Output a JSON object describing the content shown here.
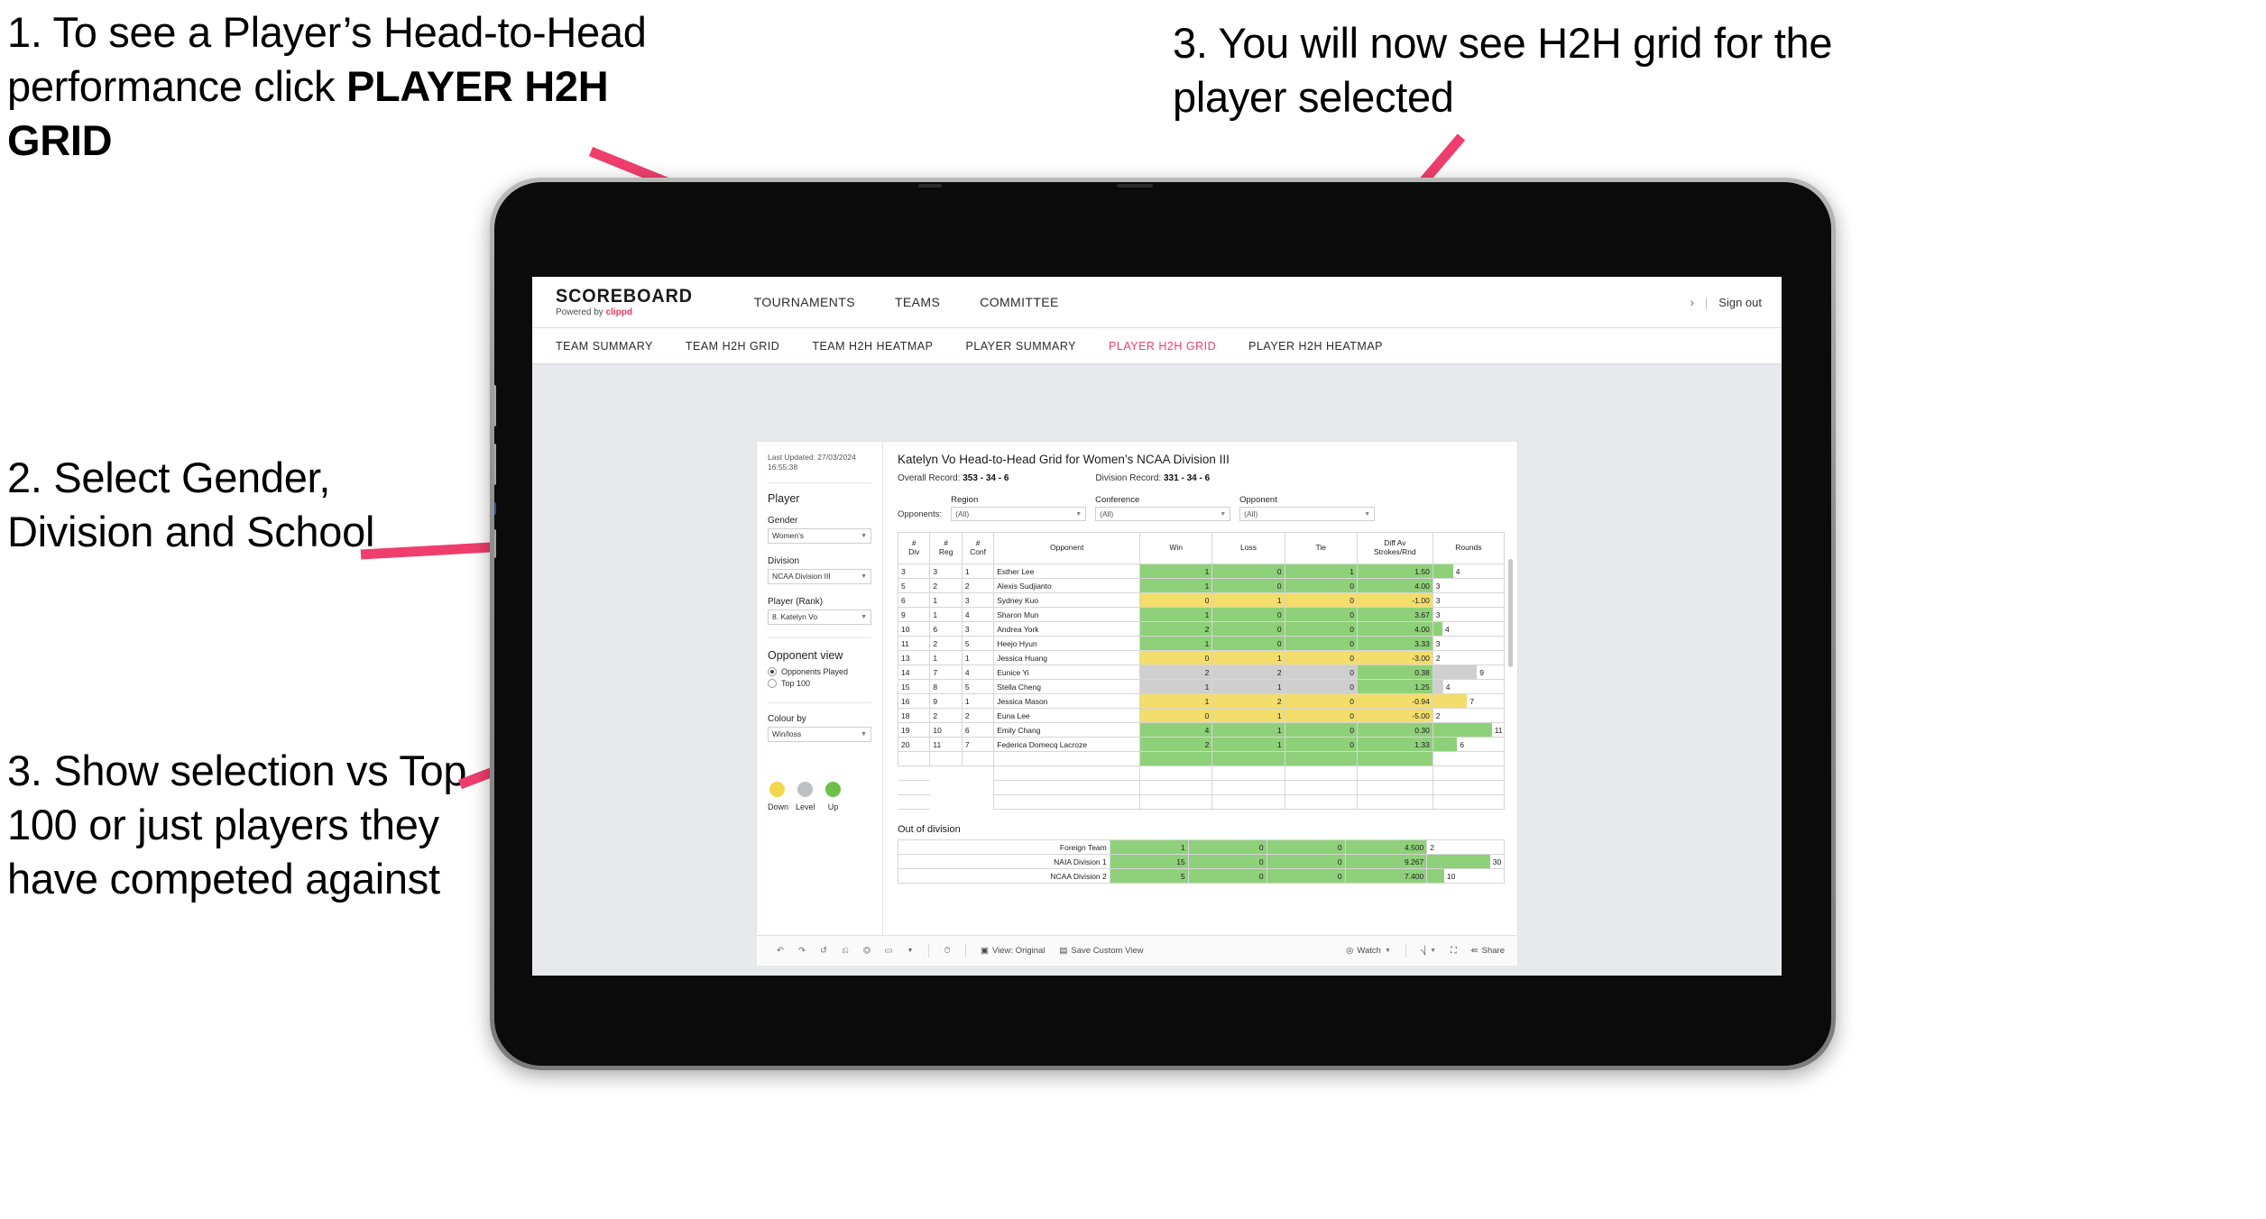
{
  "annotations": [
    {
      "id": "a1",
      "text_plain": "1. To see a Player’s Head-to-Head performance click ",
      "bold": "PLAYER H2H GRID"
    },
    {
      "id": "a2",
      "text": "2. Select Gender, Division and School"
    },
    {
      "id": "a3",
      "text": "3. Show selection vs Top 100 or just players they have competed against"
    },
    {
      "id": "a4",
      "text": "3. You will now see H2H grid for the player selected"
    }
  ],
  "colors": {
    "accent_pink": "#ef3e6d",
    "win_green": "#8fd07a",
    "loss_yellow": "#f3dd6b",
    "tie_grey": "#cfcfcf",
    "canvas_bg": "#e7e9ed"
  },
  "header": {
    "brand_name": "SCOREBOARD",
    "brand_sub_prefix": "Powered by ",
    "brand_sub_accent": "clippd",
    "nav": [
      {
        "label": "TOURNAMENTS"
      },
      {
        "label": "TEAMS"
      },
      {
        "label": "COMMITTEE"
      }
    ],
    "chevron": "›",
    "divider": "|",
    "sign_out": "Sign out"
  },
  "subnav": {
    "tabs": [
      {
        "label": "TEAM SUMMARY",
        "active": false
      },
      {
        "label": "TEAM H2H GRID",
        "active": false
      },
      {
        "label": "TEAM H2H HEATMAP",
        "active": false
      },
      {
        "label": "PLAYER SUMMARY",
        "active": false
      },
      {
        "label": "PLAYER H2H GRID",
        "active": true
      },
      {
        "label": "PLAYER H2H HEATMAP",
        "active": false
      }
    ]
  },
  "filters": {
    "last_updated": "Last Updated: 27/03/2024 16:55:38",
    "section_title": "Player",
    "gender_label": "Gender",
    "gender_value": "Women's",
    "division_label": "Division",
    "division_value": "NCAA Division III",
    "player_label": "Player (Rank)",
    "player_value": "8. Katelyn Vo",
    "opponent_view_title": "Opponent view",
    "opponent_view_options": [
      {
        "label": "Opponents Played",
        "selected": true
      },
      {
        "label": "Top 100",
        "selected": false
      }
    ],
    "colour_by_label": "Colour by",
    "colour_by_value": "Win/loss",
    "legend": [
      {
        "label": "Down",
        "color": "#f2d84f"
      },
      {
        "label": "Level",
        "color": "#bdc1c4"
      },
      {
        "label": "Up",
        "color": "#6cbf4a"
      }
    ]
  },
  "viz": {
    "title": "Katelyn Vo Head-to-Head Grid for Women’s NCAA Division III",
    "overall_record_label": "Overall Record: ",
    "overall_record_value": "353 - 34 - 6",
    "division_record_label": "Division Record: ",
    "division_record_value": "331 - 34 - 6",
    "opponents_label": "Opponents:",
    "opponent_filters": [
      {
        "caption": "Region",
        "value": "(All)"
      },
      {
        "caption": "Conference",
        "value": "(All)"
      },
      {
        "caption": "Opponent",
        "value": "(All)"
      }
    ],
    "columns": [
      {
        "l1": "#",
        "l2": "Div"
      },
      {
        "l1": "#",
        "l2": "Reg"
      },
      {
        "l1": "#",
        "l2": "Conf"
      },
      {
        "l1": "Opponent",
        "l2": ""
      },
      {
        "l1": "Win",
        "l2": ""
      },
      {
        "l1": "Loss",
        "l2": ""
      },
      {
        "l1": "Tie",
        "l2": ""
      },
      {
        "l1": "Diff Av",
        "l2": "Strokes/Rnd"
      },
      {
        "l1": "Rounds",
        "l2": ""
      }
    ],
    "rows": [
      {
        "div": "3",
        "reg": "3",
        "conf": "1",
        "opponent": "Esther Lee",
        "win": "1",
        "loss": "0",
        "tie": "1",
        "diff": "1.50",
        "rounds": "4",
        "state": "up",
        "rounds_pct": 28
      },
      {
        "div": "5",
        "reg": "2",
        "conf": "2",
        "opponent": "Alexis Sudjianto",
        "win": "1",
        "loss": "0",
        "tie": "0",
        "diff": "4.00",
        "rounds": "3",
        "state": "up",
        "rounds_pct": 0
      },
      {
        "div": "6",
        "reg": "1",
        "conf": "3",
        "opponent": "Sydney Kuo",
        "win": "0",
        "loss": "1",
        "tie": "0",
        "diff": "-1.00",
        "rounds": "3",
        "state": "down",
        "rounds_pct": 0
      },
      {
        "div": "9",
        "reg": "1",
        "conf": "4",
        "opponent": "Sharon Mun",
        "win": "1",
        "loss": "0",
        "tie": "0",
        "diff": "3.67",
        "rounds": "3",
        "state": "up",
        "rounds_pct": 0
      },
      {
        "div": "10",
        "reg": "6",
        "conf": "3",
        "opponent": "Andrea York",
        "win": "2",
        "loss": "0",
        "tie": "0",
        "diff": "4.00",
        "rounds": "4",
        "state": "up",
        "rounds_pct": 13
      },
      {
        "div": "11",
        "reg": "2",
        "conf": "5",
        "opponent": "Heejo Hyun",
        "win": "1",
        "loss": "0",
        "tie": "0",
        "diff": "3.33",
        "rounds": "3",
        "state": "up",
        "rounds_pct": 0
      },
      {
        "div": "13",
        "reg": "1",
        "conf": "1",
        "opponent": "Jessica Huang",
        "win": "0",
        "loss": "1",
        "tie": "0",
        "diff": "-3.00",
        "rounds": "2",
        "state": "down",
        "rounds_pct": 0
      },
      {
        "div": "14",
        "reg": "7",
        "conf": "4",
        "opponent": "Eunice Yi",
        "win": "2",
        "loss": "2",
        "tie": "0",
        "diff": "0.38",
        "rounds": "9",
        "state": "level",
        "diff_state": "up",
        "rounds_pct": 62
      },
      {
        "div": "15",
        "reg": "8",
        "conf": "5",
        "opponent": "Stella Cheng",
        "win": "1",
        "loss": "1",
        "tie": "0",
        "diff": "1.25",
        "rounds": "4",
        "state": "level",
        "diff_state": "up",
        "rounds_pct": 14
      },
      {
        "div": "16",
        "reg": "9",
        "conf": "1",
        "opponent": "Jessica Mason",
        "win": "1",
        "loss": "2",
        "tie": "0",
        "diff": "-0.94",
        "rounds": "7",
        "state": "down",
        "rounds_pct": 48
      },
      {
        "div": "18",
        "reg": "2",
        "conf": "2",
        "opponent": "Euna Lee",
        "win": "0",
        "loss": "1",
        "tie": "0",
        "diff": "-5.00",
        "rounds": "2",
        "state": "down",
        "rounds_pct": 0
      },
      {
        "div": "19",
        "reg": "10",
        "conf": "6",
        "opponent": "Emily Chang",
        "win": "4",
        "loss": "1",
        "tie": "0",
        "diff": "0.30",
        "rounds": "11",
        "state": "up",
        "rounds_pct": 83
      },
      {
        "div": "20",
        "reg": "11",
        "conf": "7",
        "opponent": "Federica Domecq Lacroze",
        "win": "2",
        "loss": "1",
        "tie": "0",
        "diff": "1.33",
        "rounds": "6",
        "state": "up",
        "rounds_pct": 34
      }
    ],
    "out_of_division_title": "Out of division",
    "out_of_division_rows": [
      {
        "name": "Foreign Team",
        "win": "1",
        "loss": "0",
        "tie": "0",
        "diff": "4.500",
        "rounds": "2",
        "state": "up",
        "rounds_pct": 0
      },
      {
        "name": "NAIA Division 1",
        "win": "15",
        "loss": "0",
        "tie": "0",
        "diff": "9.267",
        "rounds": "30",
        "state": "up",
        "rounds_pct": 82
      },
      {
        "name": "NCAA Division 2",
        "win": "5",
        "loss": "0",
        "tie": "0",
        "diff": "7.400",
        "rounds": "10",
        "state": "up",
        "rounds_pct": 22
      }
    ]
  },
  "toolbar": {
    "icons": [
      "undo-icon",
      "redo-icon",
      "revert-icon",
      "refresh-icon",
      "pause-icon",
      "rect-select-icon",
      "caret-down-icon",
      "clock-icon"
    ],
    "view_original": "View: Original",
    "save_custom_view": "Save Custom View",
    "watch": "Watch",
    "share": "Share",
    "caret": "▾"
  }
}
